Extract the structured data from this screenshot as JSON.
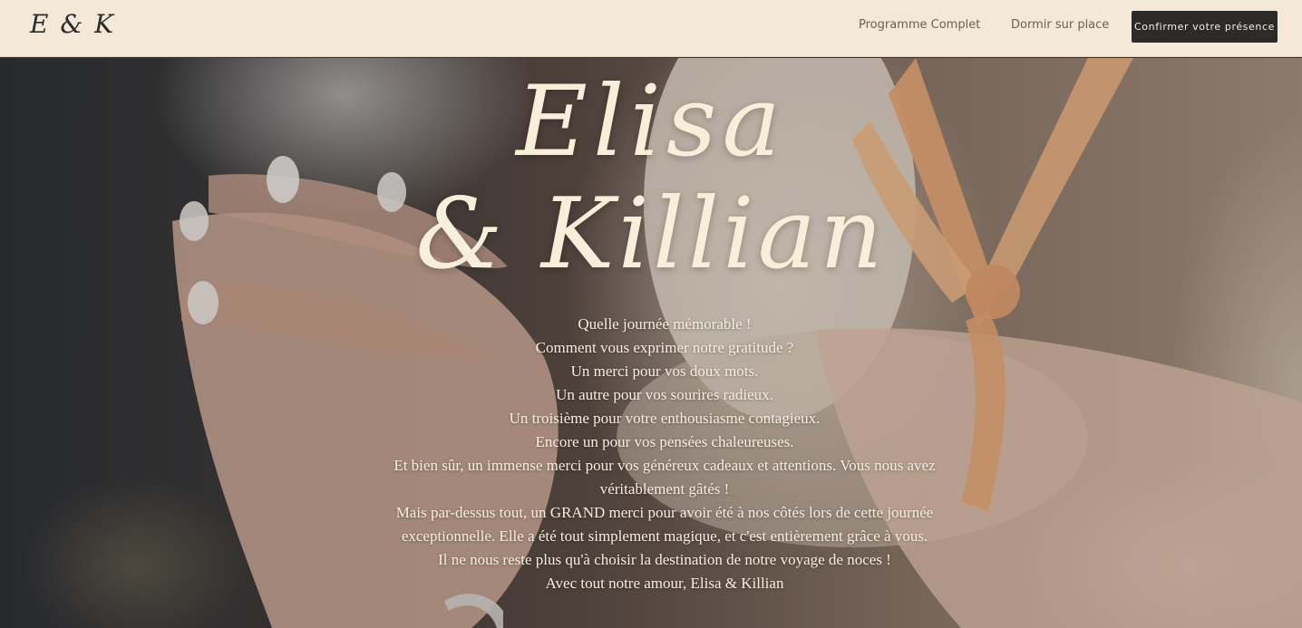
{
  "header": {
    "logo": "E & K",
    "nav": {
      "program_label": "Programme Complet",
      "dormir_label": "Dormir sur place"
    },
    "cta_label": "Confirmer votre présence"
  },
  "hero": {
    "title_line1": "Elisa",
    "title_line2": "& Killian",
    "message_lines": [
      "Quelle journée mémorable !",
      "Comment vous exprimer notre gratitude ?",
      "Un merci pour vos doux mots.",
      "Un autre pour vos sourires radieux.",
      "Un troisième pour votre enthousiasme contagieux.",
      "Encore un pour vos pensées chaleureuses.",
      "Et bien sûr, un immense merci pour vos généreux cadeaux et attentions. Vous nous avez véritablement gâtés !",
      "Mais par-dessus tout, un GRAND merci pour avoir été à nos côtés lors de cette journée exceptionnelle. Elle a été tout simplement magique, et c'est entièrement grâce à vous.",
      "Il ne nous reste plus qu'à choisir la destination de notre voyage de noces !",
      "Avec tout notre amour, Elisa & Killian"
    ]
  },
  "colors": {
    "header_bg": "#f4e8d9",
    "cta_bg": "#2d2b29",
    "title_color": "#f7efd9",
    "ribbon": "#e8a878"
  }
}
